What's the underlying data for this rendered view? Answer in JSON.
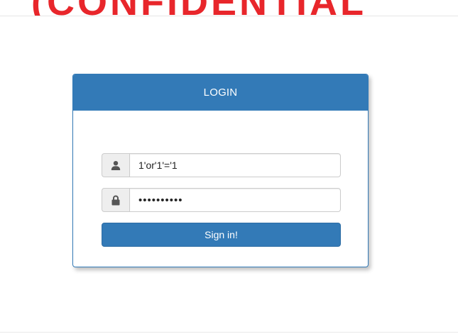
{
  "banner": {
    "stamp_text": "(CONFIDENTIAL"
  },
  "login": {
    "heading": "LOGIN",
    "username": {
      "value": "1'or'1'='1",
      "icon": "user-icon"
    },
    "password": {
      "value": "1'or'1'='1",
      "icon": "lock-icon"
    },
    "submit_label": "Sign in!"
  },
  "colors": {
    "primary": "#337ab7",
    "addon_bg": "#eeeeee",
    "border": "#cccccc",
    "stamp": "#e8262b"
  }
}
